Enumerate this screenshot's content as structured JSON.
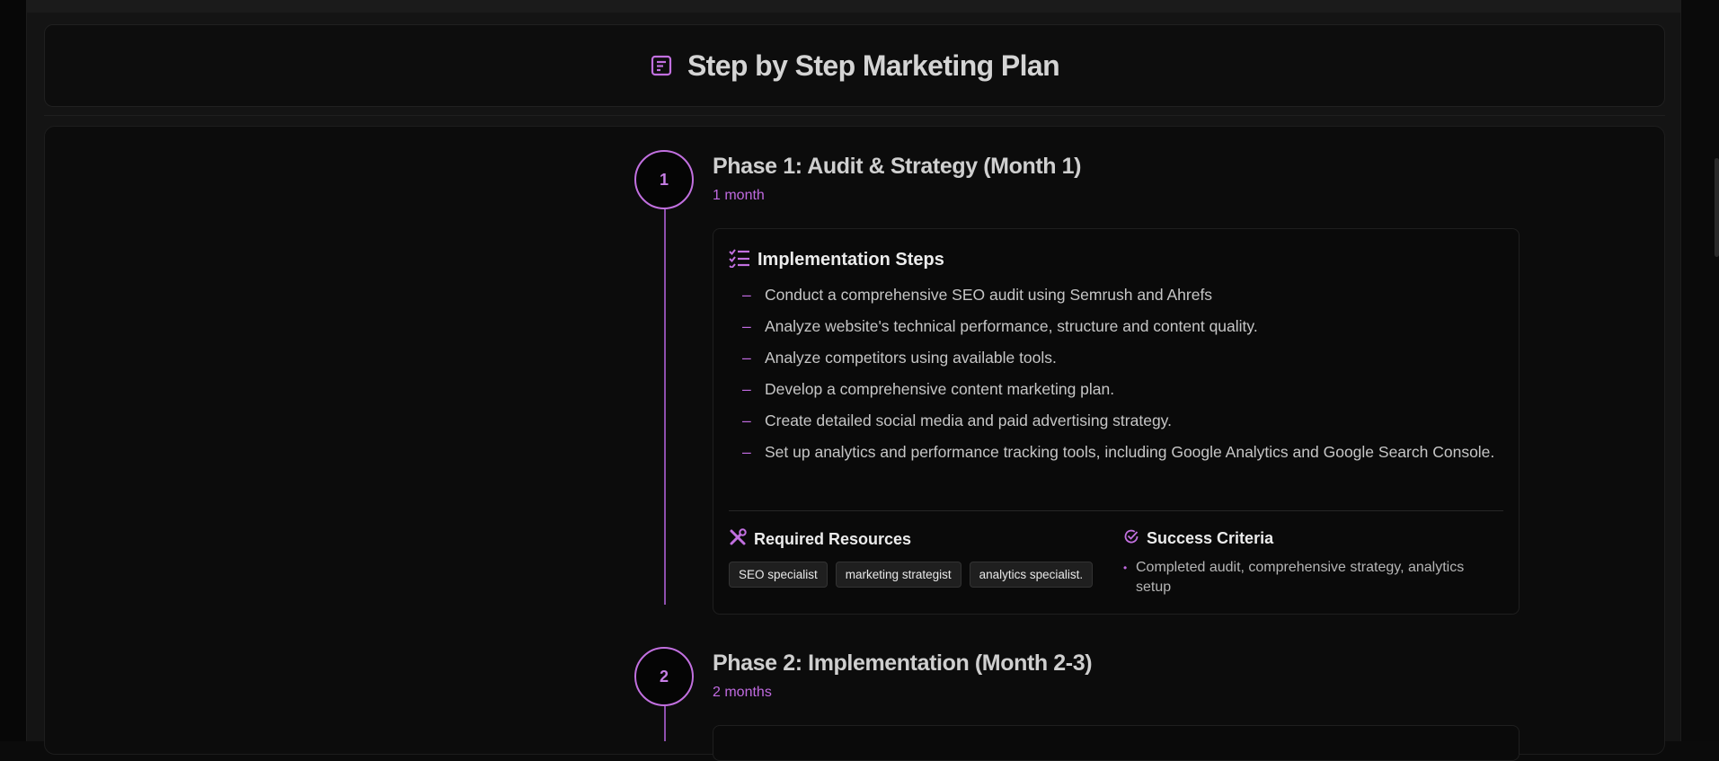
{
  "page": {
    "title": "Step by Step Marketing Plan",
    "accent_color": "#c270e0",
    "title_icon": "document-icon"
  },
  "phases": [
    {
      "number": "1",
      "title": "Phase 1: Audit & Strategy (Month 1)",
      "duration": "1 month",
      "steps_heading": "Implementation Steps",
      "steps": [
        "Conduct a comprehensive SEO audit using Semrush and Ahrefs",
        "Analyze website's technical performance, structure and content quality.",
        "Analyze competitors using available tools.",
        "Develop a comprehensive content marketing plan.",
        "Create detailed social media and paid advertising strategy.",
        "Set up analytics and performance tracking tools, including Google Analytics and Google Search Console."
      ],
      "resources_heading": "Required Resources",
      "resources": [
        "SEO specialist",
        "marketing strategist",
        "analytics specialist."
      ],
      "criteria_heading": "Success Criteria",
      "criteria": [
        "Completed audit, comprehensive strategy, analytics setup"
      ]
    },
    {
      "number": "2",
      "title": "Phase 2: Implementation (Month 2-3)",
      "duration": "2 months"
    }
  ]
}
